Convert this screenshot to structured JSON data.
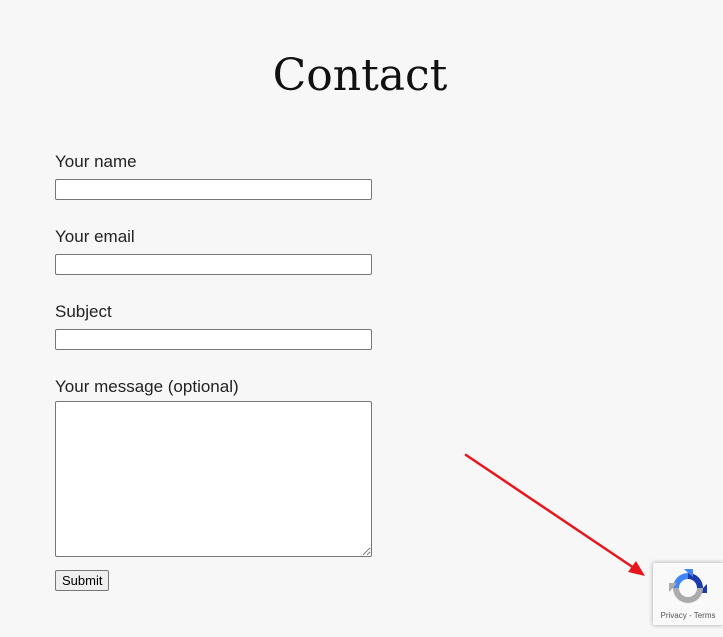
{
  "page": {
    "title": "Contact"
  },
  "form": {
    "name_label": "Your name",
    "name_value": "",
    "email_label": "Your email",
    "email_value": "",
    "subject_label": "Subject",
    "subject_value": "",
    "message_label": "Your message (optional)",
    "message_value": "",
    "submit_label": "Submit"
  },
  "recaptcha": {
    "privacy_label": "Privacy",
    "separator": " - ",
    "terms_label": "Terms"
  },
  "annotation": {
    "arrow_color": "#e8161b"
  }
}
